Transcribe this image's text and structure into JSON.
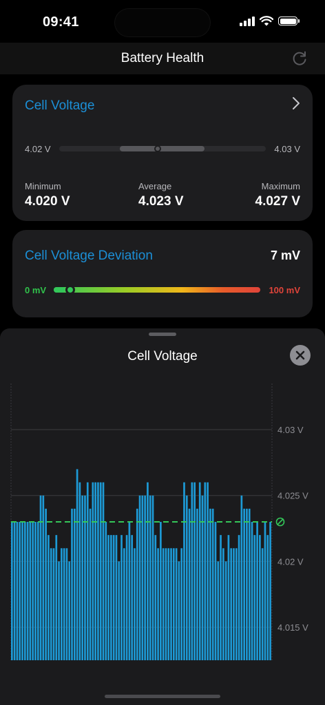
{
  "status": {
    "time": "09:41"
  },
  "nav": {
    "title": "Battery Health"
  },
  "cell_voltage_card": {
    "title": "Cell Voltage",
    "range_min_label": "4.02 V",
    "range_max_label": "4.03 V",
    "minimum": {
      "label": "Minimum",
      "value": "4.020 V"
    },
    "average": {
      "label": "Average",
      "value": "4.023 V"
    },
    "maximum": {
      "label": "Maximum",
      "value": "4.027 V"
    }
  },
  "deviation_card": {
    "title": "Cell Voltage Deviation",
    "value": "7 mV",
    "gauge_min_label": "0 mV",
    "gauge_max_label": "100 mV",
    "gauge_level": 0.07
  },
  "sheet": {
    "title": "Cell Voltage"
  },
  "colors": {
    "accent": "#1c8fd6",
    "bar": "#1d9ad6",
    "average_line": "#34c759"
  },
  "chart_data": {
    "type": "bar",
    "title": "Cell Voltage",
    "ylabel": "",
    "xlabel": "",
    "y_ticks": [
      "4.015 V",
      "4.02 V",
      "4.025 V",
      "4.03 V"
    ],
    "y_tick_values": [
      4.015,
      4.02,
      4.025,
      4.03
    ],
    "ylim": [
      4.0125,
      4.0335
    ],
    "average_line": 4.023,
    "values": [
      4.023,
      4.023,
      4.023,
      4.023,
      4.023,
      4.023,
      4.023,
      4.023,
      4.023,
      4.023,
      4.023,
      4.025,
      4.025,
      4.024,
      4.022,
      4.021,
      4.021,
      4.022,
      4.02,
      4.021,
      4.021,
      4.021,
      4.02,
      4.024,
      4.024,
      4.027,
      4.026,
      4.025,
      4.025,
      4.026,
      4.024,
      4.026,
      4.026,
      4.026,
      4.026,
      4.026,
      4.023,
      4.022,
      4.022,
      4.022,
      4.022,
      4.02,
      4.022,
      4.021,
      4.022,
      4.023,
      4.022,
      4.021,
      4.024,
      4.025,
      4.025,
      4.025,
      4.026,
      4.025,
      4.025,
      4.022,
      4.021,
      4.023,
      4.021,
      4.021,
      4.021,
      4.021,
      4.021,
      4.021,
      4.02,
      4.021,
      4.026,
      4.025,
      4.024,
      4.026,
      4.026,
      4.024,
      4.026,
      4.025,
      4.026,
      4.026,
      4.024,
      4.024,
      4.023,
      4.02,
      4.022,
      4.021,
      4.02,
      4.022,
      4.021,
      4.021,
      4.021,
      4.022,
      4.025,
      4.024,
      4.024,
      4.024,
      4.023,
      4.022,
      4.023,
      4.022,
      4.021,
      4.023,
      4.022,
      4.023
    ]
  }
}
